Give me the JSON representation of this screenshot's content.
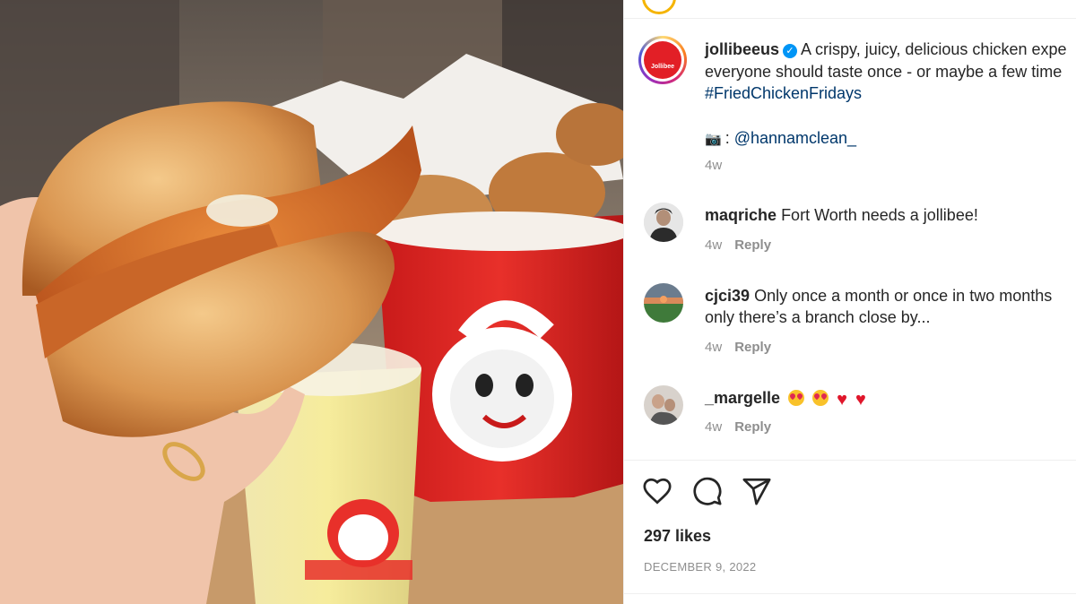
{
  "post": {
    "author": "jollibeeus",
    "caption_lines": [
      "A crispy, juicy, delicious chicken expe",
      "everyone should taste once - or maybe a few time"
    ],
    "hashtag": "#FriedChickenFridays",
    "photo_credit": "@hannamclean_",
    "time": "4w",
    "likes": "297 likes",
    "date": "DECEMBER 9, 2022",
    "brand_color": "#e21f26",
    "link_color": "#00376b",
    "verified_color": "#0095f6"
  },
  "comments": [
    {
      "user": "maqriche",
      "text": "Fort Worth needs a jollibee!",
      "time": "4w",
      "reply": "Reply"
    },
    {
      "user": "cjci39",
      "text_lines": [
        "Only once a month or once in two months",
        "only there’s a branch close by..."
      ],
      "time": "4w",
      "reply": "Reply"
    },
    {
      "user": "_margelle",
      "emojis": [
        "smiling-face-with-heart-eyes",
        "smiling-face-with-heart-eyes",
        "red-heart",
        "red-heart"
      ],
      "time": "4w",
      "reply": "Reply"
    }
  ],
  "actions": {
    "like_icon": "heart-icon",
    "comment_icon": "comment-icon",
    "share_icon": "share-icon"
  }
}
